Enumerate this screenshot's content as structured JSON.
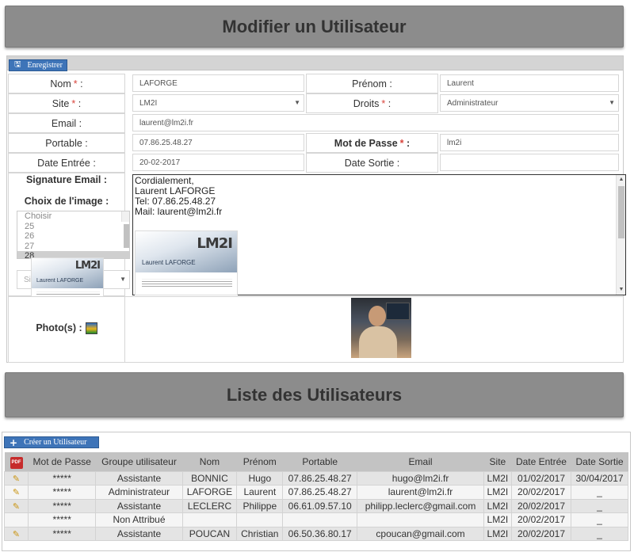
{
  "edit_title": "Modifier un Utilisateur",
  "toolbar": {
    "save_label": "Enregistrer",
    "save_icon": "floppy-disk-icon"
  },
  "form": {
    "nom": {
      "label": "Nom",
      "value": "LAFORGE"
    },
    "prenom": {
      "label": "Prénom :",
      "value": "Laurent"
    },
    "site": {
      "label": "Site",
      "value": "LM2I"
    },
    "droits": {
      "label": "Droits",
      "value": "Administrateur"
    },
    "email": {
      "label": "Email :",
      "value": "laurent@lm2i.fr"
    },
    "portable": {
      "label": "Portable :",
      "value": "07.86.25.48.27"
    },
    "mot_de_passe": {
      "label": "Mot de Passe",
      "value": "lm2i"
    },
    "date_entree": {
      "label": "Date Entrée :",
      "value": "20-02-2017"
    },
    "date_sortie": {
      "label": "Date Sortie :",
      "value": ""
    },
    "signature": {
      "label": "Signature Email :",
      "lines": [
        "Cordialement,",
        "Laurent LAFORGE",
        "Tel: 07.86.25.48.27",
        "Mail: laurent@lm2i.fr"
      ]
    },
    "choix_image": {
      "label": "Choix de l'image :",
      "options": [
        "Choisir",
        "25",
        "26",
        "27",
        "28"
      ],
      "selected": "28"
    },
    "site_select_placeholder": "Site",
    "photos_label": "Photo(s) :",
    "required_mark": "*",
    "colon": ":"
  },
  "bizcard": {
    "logo": "LM2I",
    "name": "Laurent LAFORGE"
  },
  "list_title": "Liste des Utilisateurs",
  "list_toolbar": {
    "create_label": "Créer un Utilisateur",
    "create_icon": "plus-icon"
  },
  "table": {
    "headers": [
      "Mot de Passe",
      "Groupe utilisateur",
      "Nom",
      "Prénom",
      "Portable",
      "Email",
      "Site",
      "Date Entrée",
      "Date Sortie"
    ],
    "rows": [
      {
        "pw": "*****",
        "groupe": "Assistante",
        "nom": "BONNIC",
        "prenom": "Hugo",
        "portable": "07.86.25.48.27",
        "email": "hugo@lm2i.fr",
        "site": "LM2I",
        "entree": "01/02/2017",
        "sortie": "30/04/2017",
        "editable": true
      },
      {
        "pw": "*****",
        "groupe": "Administrateur",
        "nom": "LAFORGE",
        "prenom": "Laurent",
        "portable": "07.86.25.48.27",
        "email": "laurent@lm2i.fr",
        "site": "LM2I",
        "entree": "20/02/2017",
        "sortie": "_",
        "editable": true
      },
      {
        "pw": "*****",
        "groupe": "Assistante",
        "nom": "LECLERC",
        "prenom": "Philippe",
        "portable": "06.61.09.57.10",
        "email": "philipp.leclerc@gmail.com",
        "site": "LM2I",
        "entree": "20/02/2017",
        "sortie": "_",
        "editable": true
      },
      {
        "pw": "*****",
        "groupe": "Non Attribué",
        "nom": "",
        "prenom": "",
        "portable": "",
        "email": "",
        "site": "LM2I",
        "entree": "20/02/2017",
        "sortie": "_",
        "editable": false
      },
      {
        "pw": "*****",
        "groupe": "Assistante",
        "nom": "POUCAN",
        "prenom": "Christian",
        "portable": "06.50.36.80.17",
        "email": "cpoucan@gmail.com",
        "site": "LM2I",
        "entree": "20/02/2017",
        "sortie": "_",
        "editable": true
      }
    ]
  },
  "colors": {
    "banner": "#8c8c8c",
    "button": "#3e74b8",
    "required": "#d9453d"
  }
}
